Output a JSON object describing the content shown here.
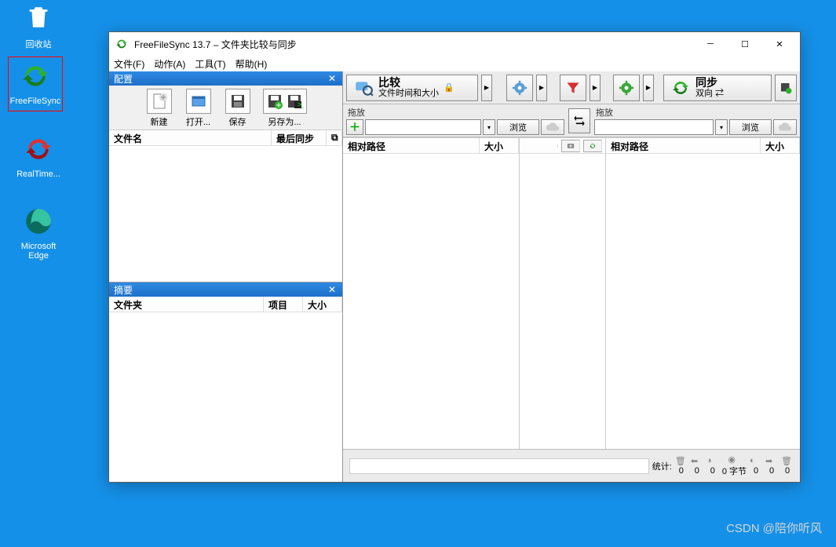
{
  "desktop": {
    "recycle": "回收站",
    "ffs": "FreeFileSync",
    "realtime": "RealTime...",
    "edge": "Microsoft Edge"
  },
  "window": {
    "title": "FreeFileSync 13.7 – 文件夹比较与同步"
  },
  "menu": {
    "file": "文件(F)",
    "action": "动作(A)",
    "tools": "工具(T)",
    "help": "帮助(H)"
  },
  "left": {
    "config_title": "配置",
    "tool_new": "新建",
    "tool_open": "打开...",
    "tool_save": "保存",
    "tool_saveas": "另存为...",
    "col_filename": "文件名",
    "col_lastsync": "最后同步",
    "summary_title": "摘要",
    "col_folder": "文件夹",
    "col_items": "项目",
    "col_size": "大小"
  },
  "actions": {
    "compare_title": "比较",
    "compare_sub": "文件时间和大小",
    "sync_title": "同步",
    "sync_sub": "双向"
  },
  "path": {
    "drag": "拖放",
    "browse": "浏览",
    "left_value": "",
    "right_value": ""
  },
  "grid": {
    "relpath": "相对路径",
    "size": "大小"
  },
  "status": {
    "label": "统计:",
    "values": [
      "0",
      "0",
      "0",
      "0 字节",
      "0",
      "0",
      "0"
    ]
  },
  "watermark": "CSDN @陪你听风"
}
